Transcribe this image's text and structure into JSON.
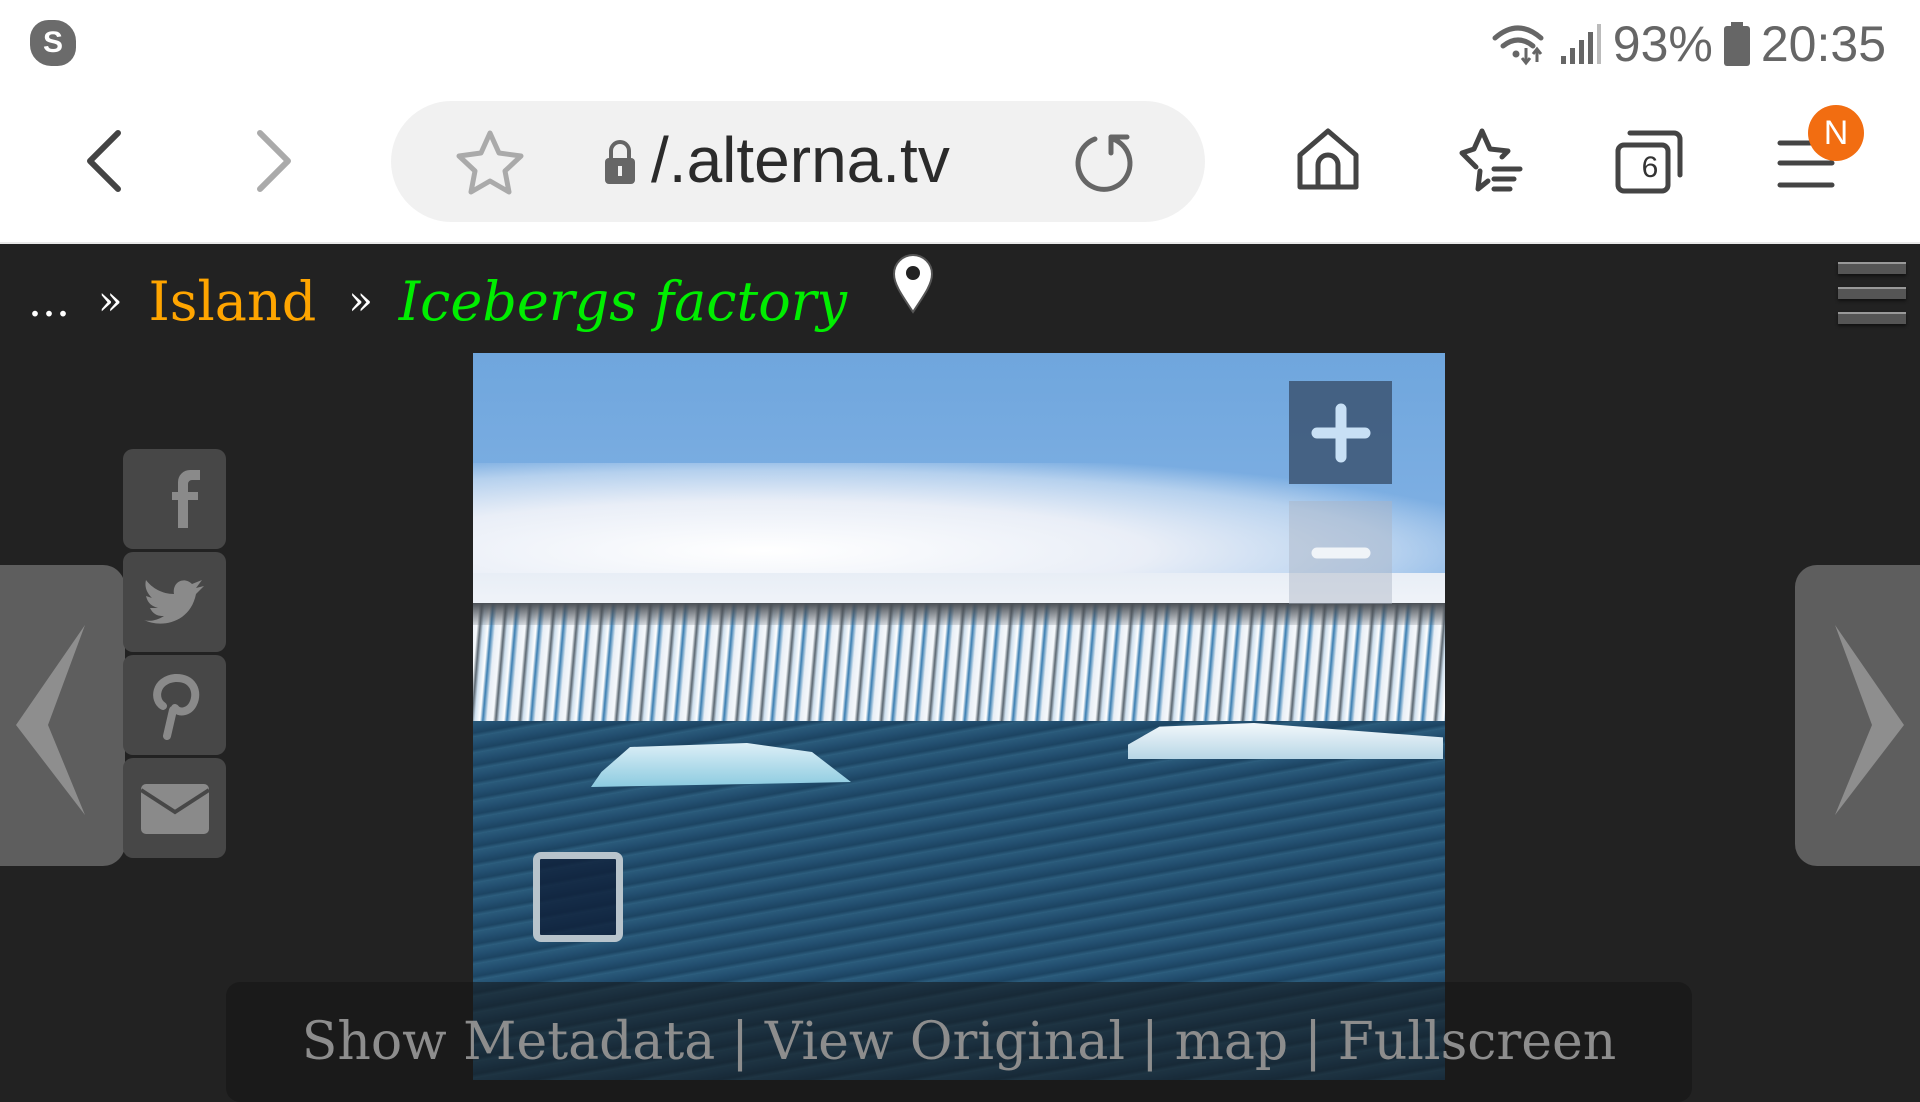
{
  "status_bar": {
    "notification_icon": "skype-icon",
    "notification_letter": "S",
    "battery_percent": "93%",
    "time": "20:35",
    "icons": [
      "wifi-icon",
      "signal-icon",
      "battery-icon"
    ]
  },
  "browser": {
    "url": "/.alterna.tv",
    "tab_count": "6",
    "profile_badge": "N",
    "icons": [
      "back-icon",
      "forward-icon",
      "bookmark-star-icon",
      "lock-icon",
      "reload-icon",
      "home-icon",
      "bookmarks-icon",
      "tabs-icon",
      "menu-icon"
    ]
  },
  "page": {
    "breadcrumb": {
      "ellipsis": "...",
      "separator": "»",
      "parent": "Island",
      "current": "Icebergs factory"
    },
    "image_alt": "Glacier lagoon with icebergs",
    "zoom_in_label": "+",
    "zoom_out_label": "−",
    "social": [
      {
        "name": "facebook",
        "icon": "facebook-icon"
      },
      {
        "name": "twitter",
        "icon": "twitter-icon"
      },
      {
        "name": "pinterest",
        "icon": "pinterest-icon"
      },
      {
        "name": "email",
        "icon": "email-icon"
      }
    ],
    "bottom_links": {
      "metadata": "Show Metadata",
      "original": "View Original",
      "map": "map",
      "fullscreen": "Fullscreen",
      "separator": "|"
    }
  },
  "colors": {
    "breadcrumb_parent": "#ffa500",
    "breadcrumb_current": "#00ee00",
    "page_background": "#222222",
    "badge": "#f26d11"
  }
}
